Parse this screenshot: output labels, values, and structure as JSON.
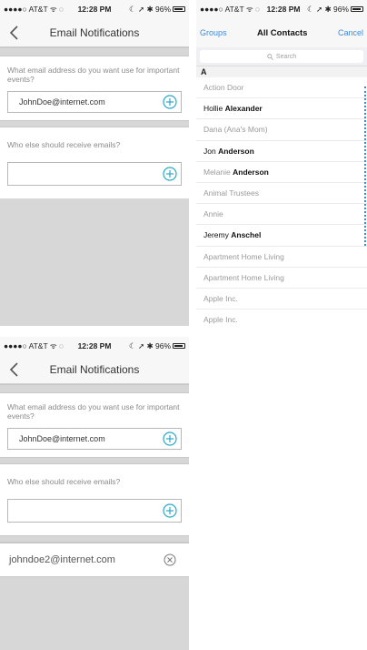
{
  "status": {
    "carrier": "●●●●○ AT&T ᯤ ◌",
    "time": "12:28 PM",
    "battery": "☾ ➚ ✱ 96%"
  },
  "screen1": {
    "nav_title": "Email Notifications",
    "important_label": "What email address do you want use for important events?",
    "important_value": "JohnDoe@internet.com",
    "others_label": "Who else should receive emails?",
    "others_value": ""
  },
  "screen2": {
    "groups": "Groups",
    "title": "All Contacts",
    "cancel": "Cancel",
    "search_placeholder": "Search",
    "section": "A",
    "contacts": [
      {
        "first": "Action Door",
        "last": "",
        "dark": false
      },
      {
        "first": "Hollie",
        "last": "Alexander",
        "dark": true
      },
      {
        "first": "Dana (Ana's Mom)",
        "last": "",
        "dark": false
      },
      {
        "first": "Jon",
        "last": "Anderson",
        "dark": true
      },
      {
        "first": "Melanie",
        "last": "Anderson",
        "dark": false
      },
      {
        "first": "Animal Trustees",
        "last": "",
        "dark": false
      },
      {
        "first": "Annie",
        "last": "",
        "dark": false
      },
      {
        "first": "Jeremy",
        "last": "Anschel",
        "dark": true
      },
      {
        "first": "Apartment Home Living",
        "last": "",
        "dark": false
      },
      {
        "first": "Apartment Home Living",
        "last": "",
        "dark": false
      },
      {
        "first": "Apple Inc.",
        "last": "",
        "dark": false
      },
      {
        "first": "Apple Inc.",
        "last": "",
        "dark": false
      }
    ]
  },
  "screen3": {
    "nav_title": "Email Notifications",
    "important_label": "What email address do you want use for important events?",
    "important_value": "JohnDoe@internet.com",
    "others_label": "Who else should receive emails?",
    "others_value": "",
    "added_email": "johndoe2@internet.com"
  },
  "colors": {
    "accent": "#3a8dde",
    "plus": "#2aa9c9",
    "background": "#d7d7d7"
  },
  "icons": [
    "back-chevron-icon",
    "plus-circle-icon",
    "close-circle-icon",
    "search-icon",
    "battery-icon"
  ]
}
